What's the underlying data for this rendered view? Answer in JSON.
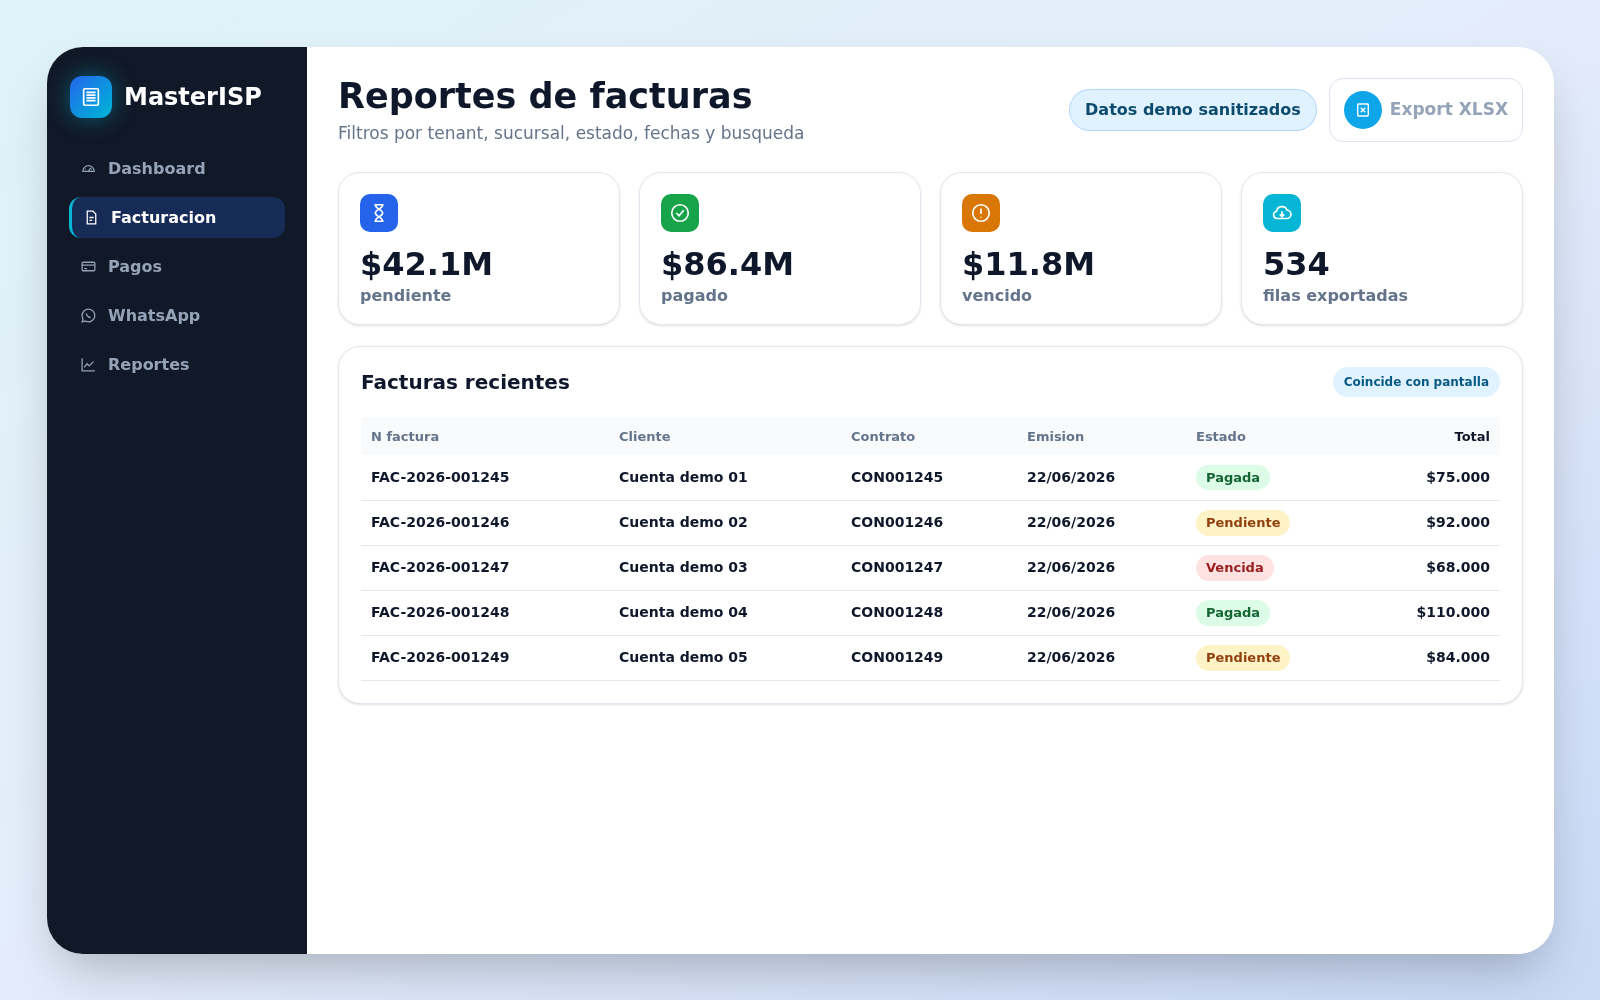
{
  "brand": {
    "name": "MasterISP"
  },
  "sidebar": {
    "items": [
      {
        "label": "Dashboard",
        "selected": false
      },
      {
        "label": "Facturacion",
        "selected": true
      },
      {
        "label": "Pagos",
        "selected": false
      },
      {
        "label": "WhatsApp",
        "selected": false
      },
      {
        "label": "Reportes",
        "selected": false
      }
    ]
  },
  "header": {
    "title": "Reportes de facturas",
    "subtitle": "Filtros por tenant, sucursal, estado, fechas y busqueda",
    "export_button": {
      "label": "Export XLSX"
    },
    "badge": "Datos demo sanitizados"
  },
  "stats": [
    {
      "value": "$42.1M",
      "label": "pendiente",
      "color": "#2563eb"
    },
    {
      "value": "$86.4M",
      "label": "pagado",
      "color": "#16a34a"
    },
    {
      "value": "$11.8M",
      "label": "vencido",
      "color": "#d97706"
    },
    {
      "value": "534",
      "label": "filas exportadas",
      "color": "#06b6d4"
    }
  ],
  "table": {
    "title": "Facturas recientes",
    "badge": "Coincide con pantalla",
    "columns": [
      "N factura",
      "Cliente",
      "Contrato",
      "Emision",
      "Estado",
      "Total"
    ],
    "rows": [
      {
        "cells": [
          "FAC-2026-001245",
          "Cuenta demo 01",
          "CON001245",
          "22/06/2026"
        ],
        "status": {
          "label": "Pagada",
          "kind": "paid"
        },
        "total": "$75.000"
      },
      {
        "cells": [
          "FAC-2026-001246",
          "Cuenta demo 02",
          "CON001246",
          "22/06/2026"
        ],
        "status": {
          "label": "Pendiente",
          "kind": "pending"
        },
        "total": "$92.000"
      },
      {
        "cells": [
          "FAC-2026-001247",
          "Cuenta demo 03",
          "CON001247",
          "22/06/2026"
        ],
        "status": {
          "label": "Vencida",
          "kind": "overdue"
        },
        "total": "$68.000"
      },
      {
        "cells": [
          "FAC-2026-001248",
          "Cuenta demo 04",
          "CON001248",
          "22/06/2026"
        ],
        "status": {
          "label": "Pagada",
          "kind": "paid"
        },
        "total": "$110.000"
      },
      {
        "cells": [
          "FAC-2026-001249",
          "Cuenta demo 05",
          "CON001249",
          "22/06/2026"
        ],
        "status": {
          "label": "Pendiente",
          "kind": "pending"
        },
        "total": "$84.000"
      }
    ]
  }
}
